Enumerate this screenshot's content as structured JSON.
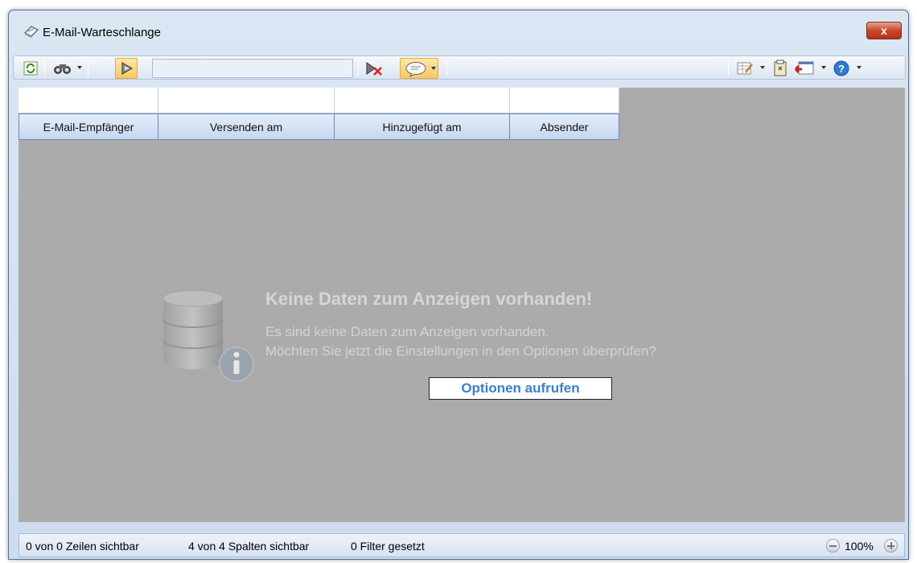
{
  "window": {
    "title": "E-Mail-Warteschlange",
    "close_label": "x"
  },
  "toolbar": {
    "search_value": "",
    "icons": [
      "refresh-icon",
      "binoculars-icon",
      "filter-brush-icon",
      "clear-filter-icon",
      "comment-icon",
      "layout-edit-icon",
      "clipboard-icon",
      "export-icon",
      "help-icon"
    ]
  },
  "grid": {
    "columns": [
      "E-Mail-Empfänger",
      "Versenden am",
      "Hinzugefügt am",
      "Absender"
    ],
    "empty_title": "Keine Daten zum Anzeigen vorhanden!",
    "empty_line1": "Es sind keine Daten zum Anzeigen vorhanden.",
    "empty_line2": "Möchten Sie jetzt die Einstellungen in den Optionen überprüfen?",
    "options_button": "Optionen aufrufen"
  },
  "status": {
    "rows": "0 von 0 Zeilen sichtbar",
    "columns": "4 von 4 Spalten sichtbar",
    "filters": "0 Filter gesetzt",
    "zoom": "100%"
  },
  "colors": {
    "accent": "#3a7fd1",
    "grid_background": "#ababab",
    "active_button": "#f9c862",
    "close_button": "#c9482c"
  }
}
